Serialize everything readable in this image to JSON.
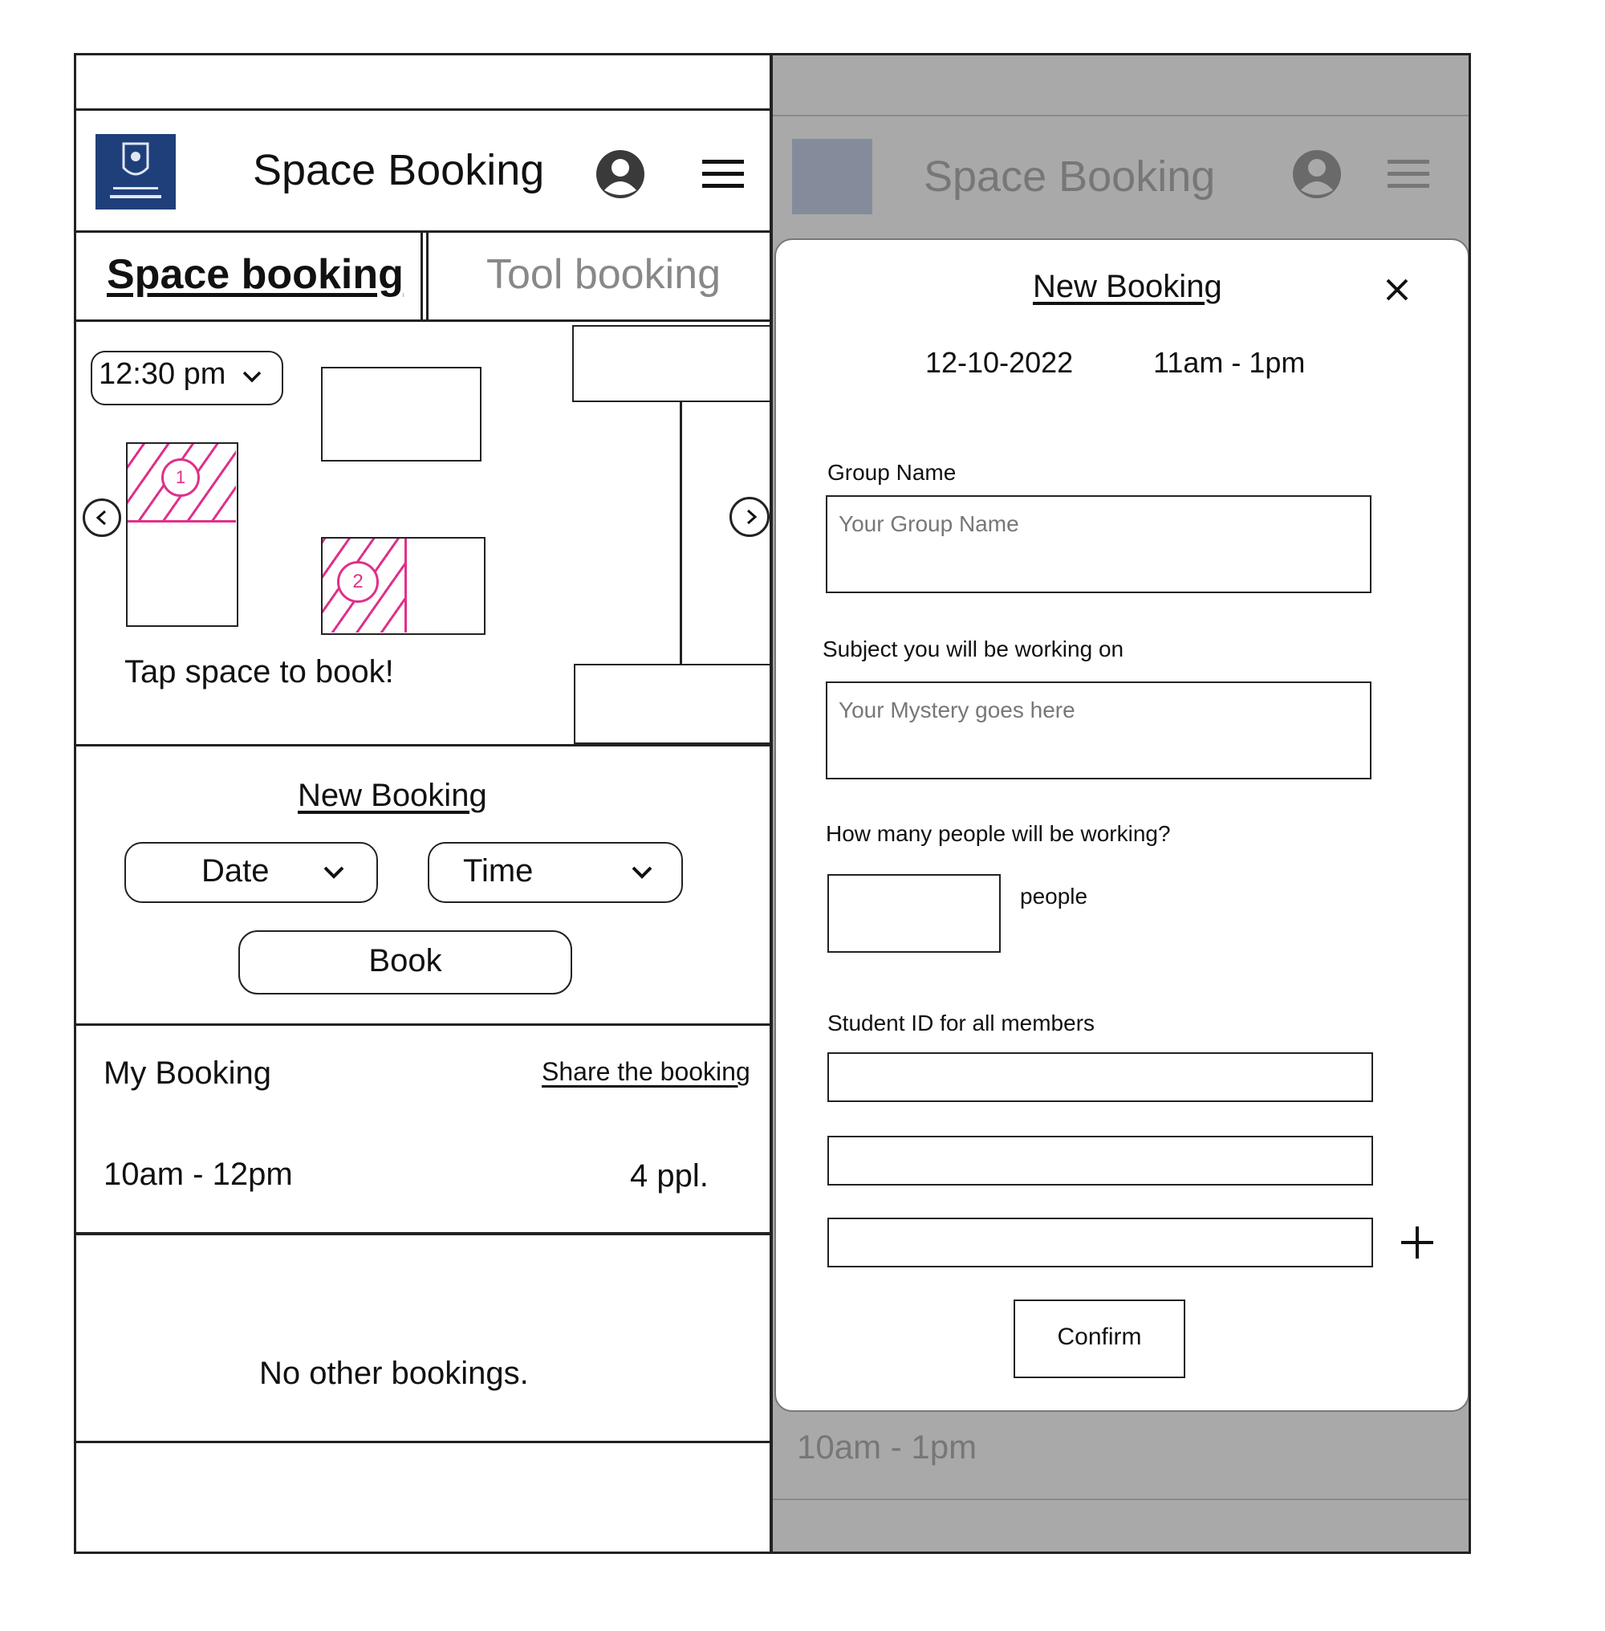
{
  "left": {
    "header": {
      "title": "Space Booking",
      "logo_icon": "university-crest-icon",
      "account_icon": "account-icon",
      "menu_icon": "hamburger-menu-icon"
    },
    "tabs": [
      {
        "label": "Space booking",
        "active": true
      },
      {
        "label": "Tool booking",
        "active": false
      }
    ],
    "map": {
      "time_select": "12:30 pm",
      "spaces": [
        {
          "number": "1",
          "booked": true
        },
        {
          "number": "2",
          "booked": true
        }
      ],
      "hint": "Tap space to book!",
      "accent": "#e0308a"
    },
    "new_booking": {
      "title": "New Booking",
      "date_label": "Date",
      "time_label": "Time",
      "book_label": "Book"
    },
    "my_booking": {
      "title": "My Booking",
      "share_label": "Share the booking",
      "time": "10am - 12pm",
      "people": "4 ppl."
    },
    "other_bookings": "No other bookings."
  },
  "right": {
    "header": {
      "title": "Space Booking"
    },
    "behind_time": "10am - 1pm",
    "overlay_color": "#a9a9a9",
    "modal": {
      "title": "New Booking",
      "date": "12-10-2022",
      "time": "11am - 1pm",
      "group_label": "Group Name",
      "group_placeholder": "Your Group Name",
      "subject_label": "Subject you will be working on",
      "subject_placeholder": "Your Mystery goes here",
      "people_label": "How many people will be working?",
      "people_unit": "people",
      "student_label": "Student ID for all members",
      "confirm_label": "Confirm"
    }
  }
}
